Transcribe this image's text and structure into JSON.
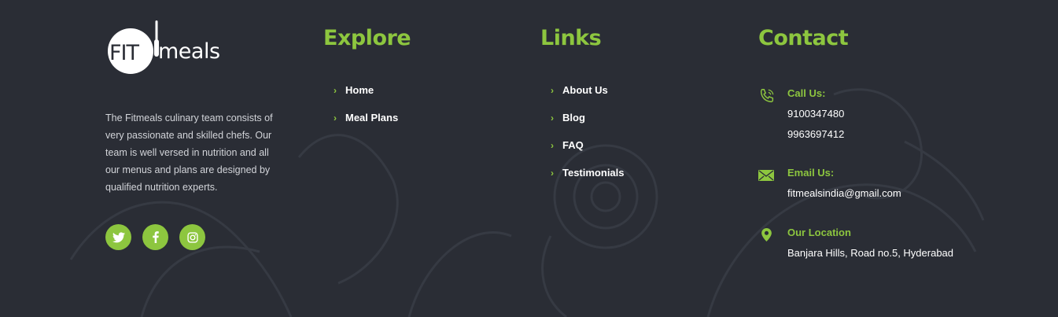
{
  "brand": {
    "logo_left": "FIT",
    "logo_right": "meals",
    "about": "The Fitmeals culinary team consists of very passionate and skilled chefs. Our team is well versed in nutrition and all our menus and plans are designed by qualified nutrition experts."
  },
  "socials": [
    {
      "icon": "twitter-icon"
    },
    {
      "icon": "facebook-icon"
    },
    {
      "icon": "instagram-icon"
    }
  ],
  "explore": {
    "heading": "Explore",
    "items": [
      "Home",
      "Meal Plans"
    ]
  },
  "links": {
    "heading": "Links",
    "items": [
      "About Us",
      "Blog",
      "FAQ",
      "Testimonials"
    ]
  },
  "contact": {
    "heading": "Contact",
    "call": {
      "title": "Call Us:",
      "phones": [
        "9100347480",
        "9963697412"
      ]
    },
    "email": {
      "title": "Email Us:",
      "address": "fitmealsindia@gmail.com"
    },
    "location": {
      "title": "Our Location",
      "address": "Banjara Hills, Road no.5, Hyderabad"
    }
  },
  "colors": {
    "accent": "#8dc63f",
    "background": "#2a2d35",
    "text": "#ffffff",
    "muted": "#d2d4d9"
  }
}
